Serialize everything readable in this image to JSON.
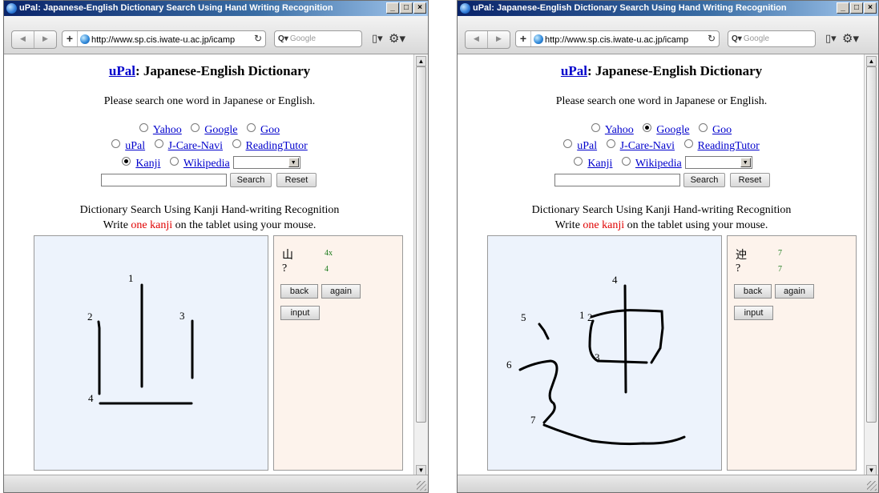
{
  "browser": {
    "title": "uPal: Japanese-English Dictionary Search Using Hand Writing Recognition",
    "url": "http://www.sp.cis.iwate-u.ac.jp/icamp",
    "search_placeholder": "Google",
    "icons": [
      "globe-icon",
      "back-arrow-icon",
      "forward-arrow-icon",
      "plus-icon",
      "reload-icon",
      "search-icon",
      "page-icon",
      "gear-icon"
    ]
  },
  "page": {
    "title_link": "uPal",
    "title_rest": ": Japanese-English Dictionary",
    "intro": "Please search one word in Japanese or English.",
    "engines": {
      "yahoo": "Yahoo",
      "google": "Google",
      "goo": "Goo",
      "upal": "uPal",
      "jcare": "J-Care-Navi",
      "reading": "ReadingTutor",
      "kanji": "Kanji",
      "wikipedia": "Wikipedia"
    },
    "search_button": "Search",
    "reset_button": "Reset",
    "section_heading": "Dictionary Search Using Kanji Hand-writing Recognition",
    "instr_pre": "Write ",
    "instr_highlight": "one kanji",
    "instr_post": " on the tablet using your mouse.",
    "back_button": "back",
    "again_button": "again",
    "input_button": "input"
  },
  "left": {
    "selected_engine": "Kanji",
    "candidate_1": "山",
    "score_1": "4x",
    "candidate_2": "?",
    "score_2": "4",
    "stroke_labels": [
      "1",
      "2",
      "3",
      "4"
    ]
  },
  "right": {
    "selected_engine": "Google",
    "candidate_1": "迚",
    "score_1": "7",
    "candidate_2": "?",
    "score_2": "7",
    "stroke_labels": [
      "1",
      "2",
      "3",
      "4",
      "5",
      "6",
      "7"
    ]
  },
  "colors": {
    "link": "#0000cc",
    "highlight": "#e00000",
    "score": "#1a7a1a",
    "canvas_bg": "#edf3fc",
    "side_bg": "#fdf3ec",
    "title_bar": "#0a246a"
  }
}
